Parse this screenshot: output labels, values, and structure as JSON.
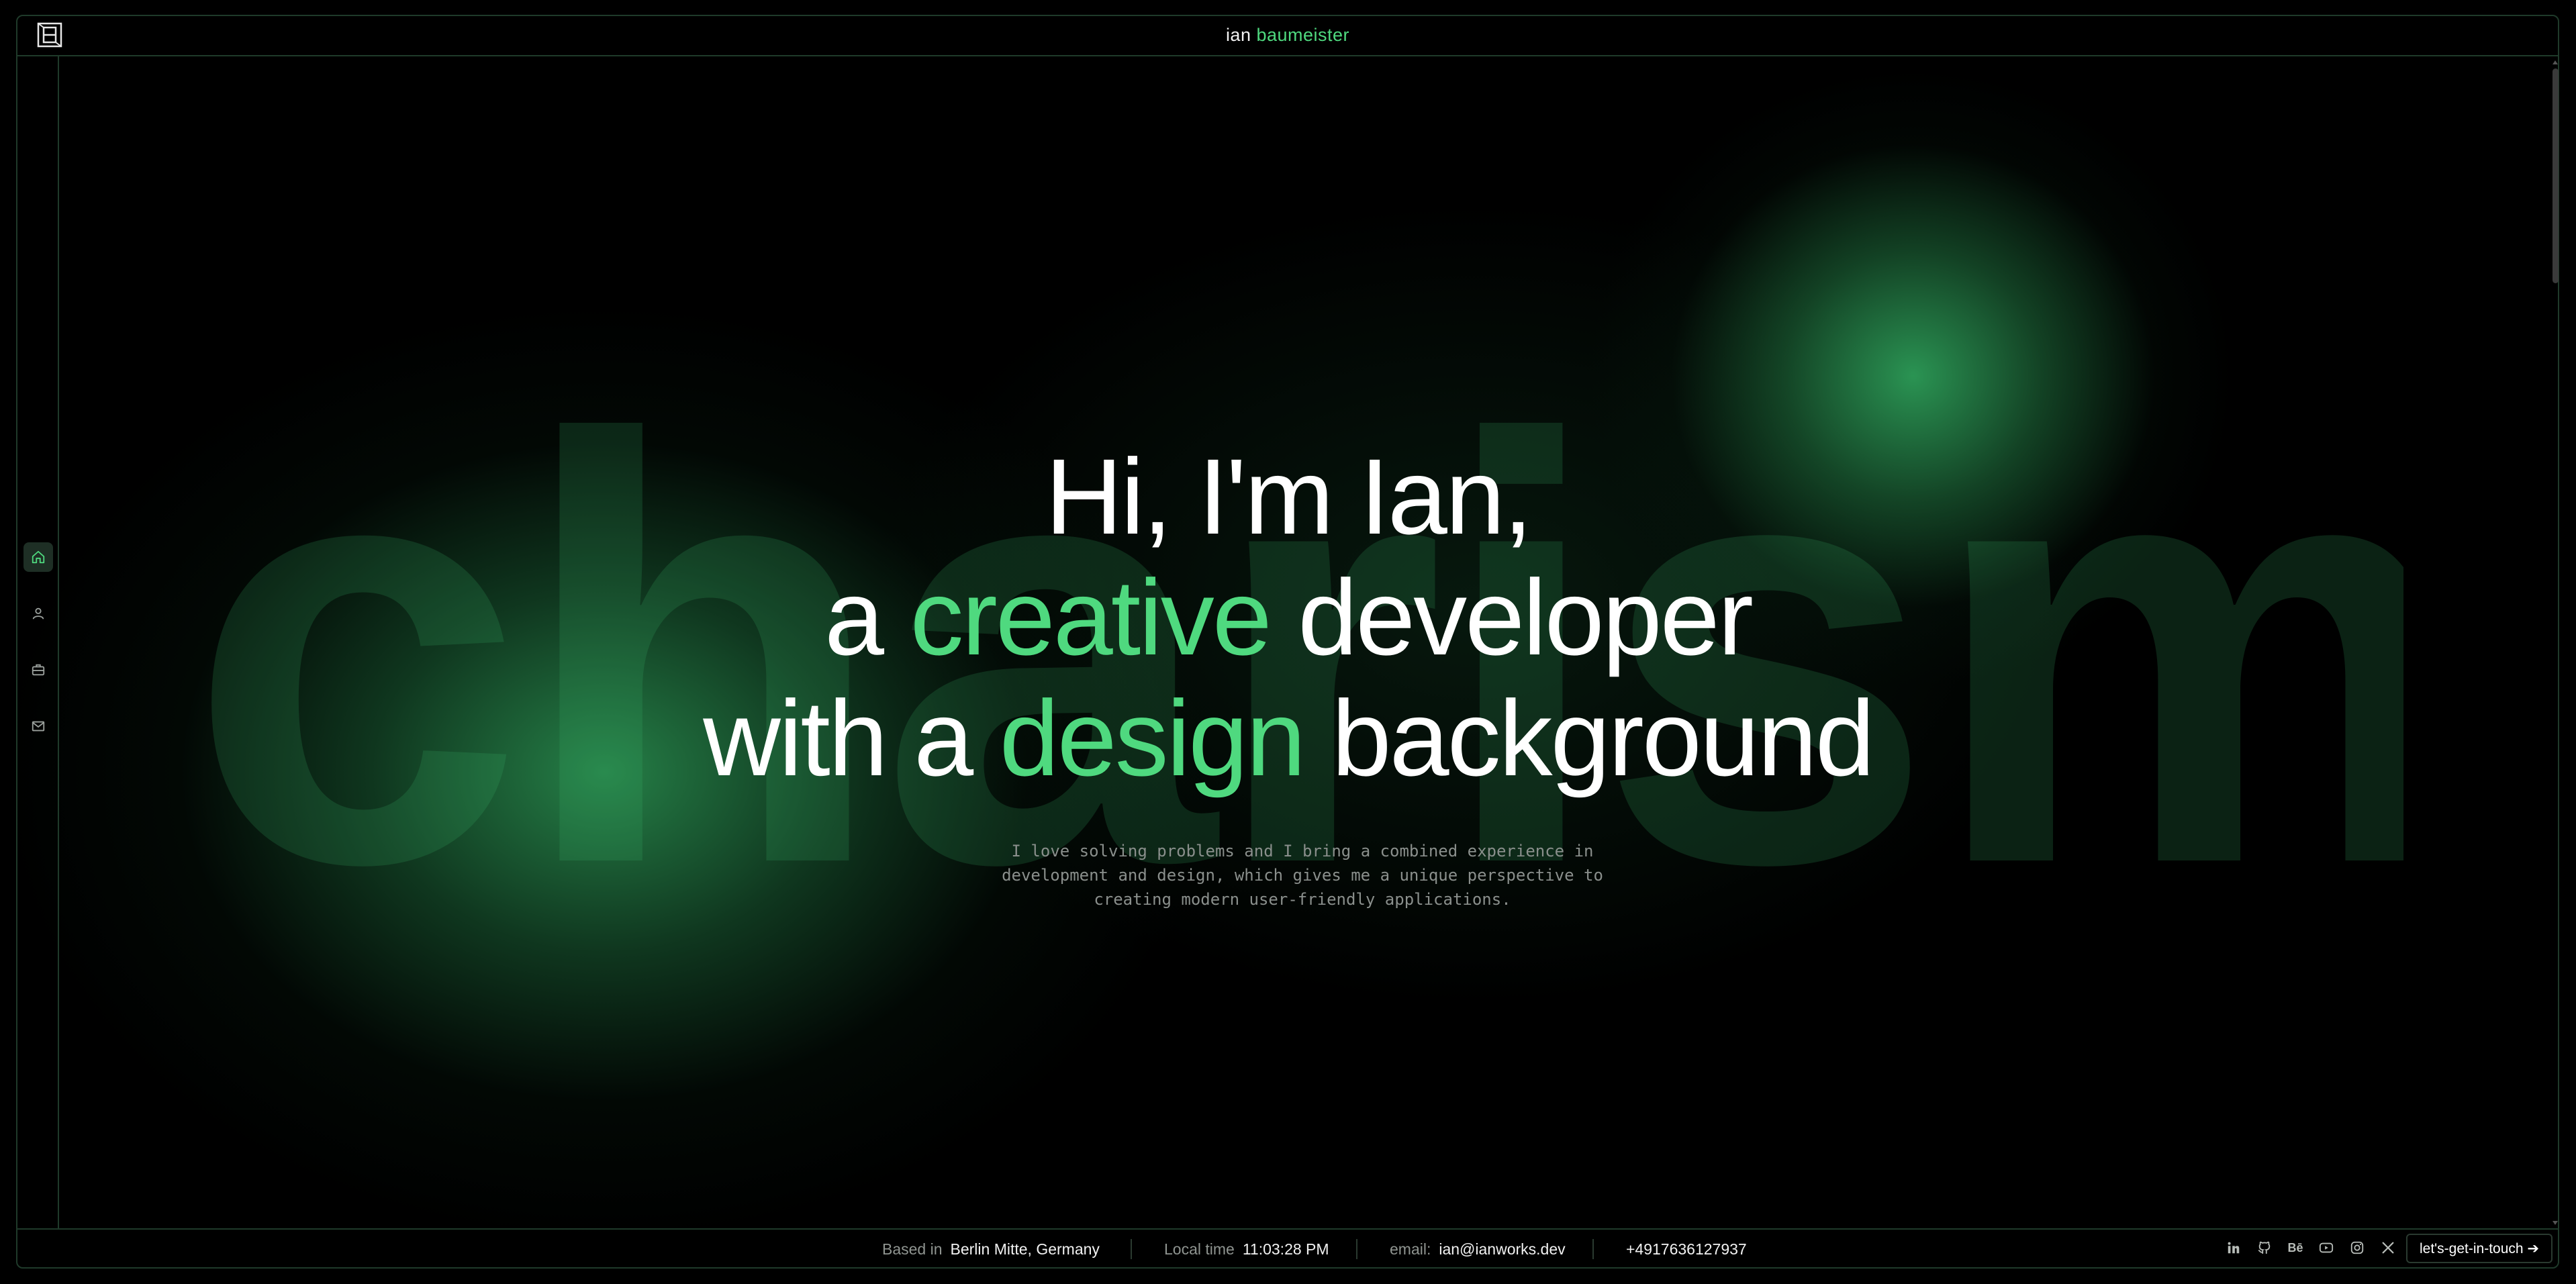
{
  "header": {
    "logo_icon": "monogram-logo-icon",
    "title_first": "ian",
    "title_last": "baumeister"
  },
  "sidebar": {
    "items": [
      {
        "name": "home",
        "icon": "home-icon",
        "active": true
      },
      {
        "name": "about",
        "icon": "user-icon",
        "active": false
      },
      {
        "name": "work",
        "icon": "briefcase-icon",
        "active": false
      },
      {
        "name": "contact",
        "icon": "mail-icon",
        "active": false
      }
    ]
  },
  "background_word": "charisma",
  "hero": {
    "line1": "Hi, I'm Ian,",
    "line2_pre": "a ",
    "line2_accent": "creative",
    "line2_post": " developer",
    "line3_pre": "with a ",
    "line3_accent": "design",
    "line3_post": " background",
    "intro": "I love solving problems and I bring a combined experience in development and design, which gives me a unique perspective to creating modern user-friendly applications."
  },
  "footer": {
    "based_label": "Based in",
    "based_value": "Berlin Mitte, Germany",
    "time_label": "Local time",
    "time_value": "11:03:28 PM",
    "email_label": "email:",
    "email_value": "ian@ianworks.dev",
    "phone": "+4917636127937",
    "socials": [
      "linkedin-icon",
      "github-icon",
      "behance-icon",
      "youtube-icon",
      "instagram-icon",
      "x-icon"
    ],
    "behance_text": "Bē",
    "cta_label": "let's-get-in-touch ➔"
  },
  "colors": {
    "accent": "#4fd97f",
    "background": "#000000",
    "border": "#1f3a2a",
    "muted_text": "#8a8f8c"
  }
}
